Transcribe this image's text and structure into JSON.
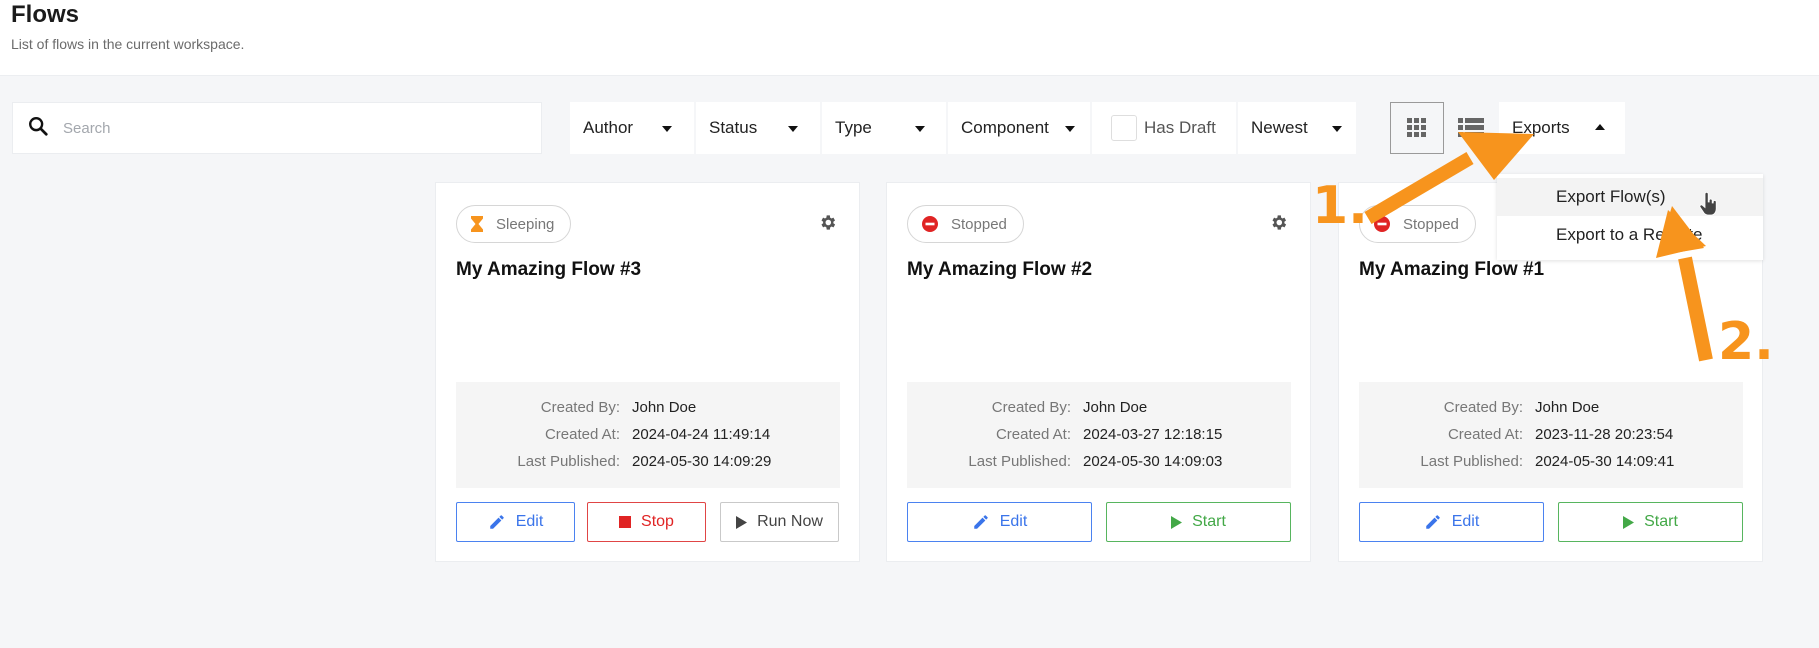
{
  "header": {
    "title": "Flows",
    "subtitle": "List of flows in the current workspace."
  },
  "toolbar": {
    "search_placeholder": "Search",
    "search_value": "",
    "filters": [
      {
        "label": "Author",
        "icon": "caret-down-icon"
      },
      {
        "label": "Status",
        "icon": "caret-down-icon"
      },
      {
        "label": "Type",
        "icon": "caret-down-icon"
      },
      {
        "label": "Component",
        "icon": "caret-down-icon"
      }
    ],
    "has_draft_label": "Has Draft",
    "has_draft_checked": false,
    "sort_label": "Newest",
    "view_modes": [
      {
        "name": "grid-view",
        "icon": "grid-icon",
        "active": true
      },
      {
        "name": "list-view",
        "icon": "list-icon",
        "active": false
      }
    ],
    "exports_label": "Exports",
    "exports_open": true
  },
  "exports_menu": {
    "items": [
      {
        "label": "Export Flow(s)",
        "hovered": true
      },
      {
        "label": "Export to a Remote",
        "hovered": false
      }
    ]
  },
  "cards": [
    {
      "status": "Sleeping",
      "status_icon": "hourglass-icon",
      "status_color": "#f7941d",
      "title": "My Amazing Flow #3",
      "meta": [
        {
          "label": "Created By:",
          "value": "John Doe"
        },
        {
          "label": "Created At:",
          "value": "2024-04-24 11:49:14"
        },
        {
          "label": "Last Published:",
          "value": "2024-05-30 14:09:29"
        }
      ],
      "actions": [
        {
          "label": "Edit",
          "icon": "pencil-icon",
          "kind": "edit"
        },
        {
          "label": "Stop",
          "icon": "stop-icon",
          "kind": "stop"
        },
        {
          "label": "Run Now",
          "icon": "play-icon",
          "kind": "run"
        }
      ]
    },
    {
      "status": "Stopped",
      "status_icon": "minus-circle-icon",
      "status_color": "#e02424",
      "title": "My Amazing Flow #2",
      "meta": [
        {
          "label": "Created By:",
          "value": "John Doe"
        },
        {
          "label": "Created At:",
          "value": "2024-03-27 12:18:15"
        },
        {
          "label": "Last Published:",
          "value": "2024-05-30 14:09:03"
        }
      ],
      "actions": [
        {
          "label": "Edit",
          "icon": "pencil-icon",
          "kind": "edit"
        },
        {
          "label": "Start",
          "icon": "play-icon",
          "kind": "start"
        }
      ]
    },
    {
      "status": "Stopped",
      "status_icon": "minus-circle-icon",
      "status_color": "#e02424",
      "title": "My Amazing Flow #1",
      "meta": [
        {
          "label": "Created By:",
          "value": "John Doe"
        },
        {
          "label": "Created At:",
          "value": "2023-11-28 20:23:54"
        },
        {
          "label": "Last Published:",
          "value": "2024-05-30 14:09:41"
        }
      ],
      "actions": [
        {
          "label": "Edit",
          "icon": "pencil-icon",
          "kind": "edit"
        },
        {
          "label": "Start",
          "icon": "play-icon",
          "kind": "start"
        }
      ]
    }
  ],
  "annotations": {
    "step1": "1.",
    "step2": "2.",
    "color": "#f7941d"
  }
}
